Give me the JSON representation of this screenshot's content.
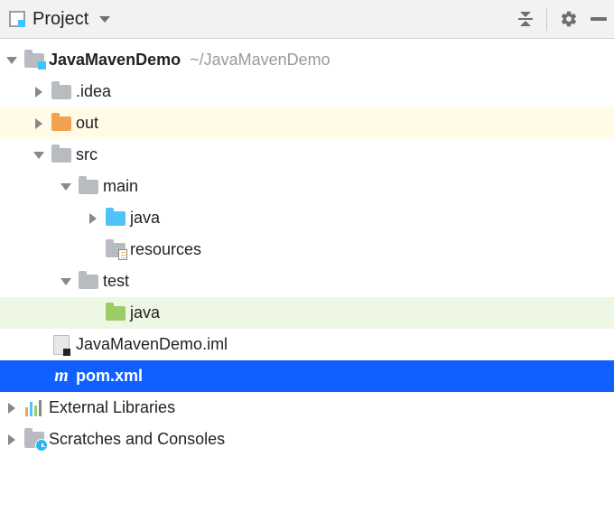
{
  "toolbar": {
    "title": "Project"
  },
  "tree": {
    "root": {
      "label": "JavaMavenDemo",
      "hint": "~/JavaMavenDemo"
    },
    "idea": ".idea",
    "out": "out",
    "src": "src",
    "main": "main",
    "main_java": "java",
    "resources": "resources",
    "test": "test",
    "test_java": "java",
    "iml": "JavaMavenDemo.iml",
    "pom": "pom.xml",
    "external": "External Libraries",
    "scratches": "Scratches and Consoles"
  }
}
